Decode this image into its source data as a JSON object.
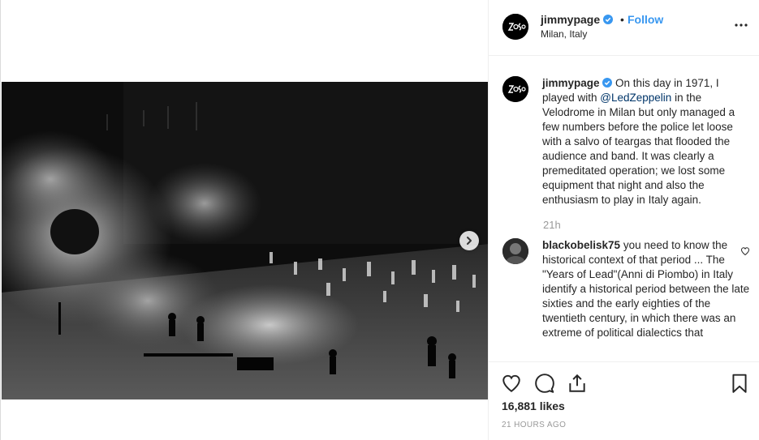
{
  "post": {
    "username": "jimmypage",
    "verified_icon": "verified-badge-icon",
    "dot": "•",
    "follow_label": "Follow",
    "location": "Milan, Italy",
    "more_icon": "more-options-icon"
  },
  "media": {
    "image_icon": "concert-teargas-photo",
    "next_icon": "chevron-right-icon"
  },
  "caption": {
    "username": "jimmypage",
    "text_before": " On this day in 1971, I played with ",
    "mention": "@LedZeppelin",
    "text_after": " in the Velodrome in Milan but only managed a few numbers before the police let loose with a salvo of teargas that flooded the audience and band. It was clearly a premeditated operation; we lost some equipment that night and also the enthusiasm to play in Italy again.",
    "time": "21h"
  },
  "comments": [
    {
      "username": "blackobelisk75",
      "text": " you need to know the historical context of that period ... The \"Years of Lead\"(Anni di Piombo) in Italy identify a historical period between the late sixties and the early eighties of the twentieth century, in which there was an extreme of political dialectics that"
    }
  ],
  "actions": {
    "like_icon": "heart-icon",
    "comment_icon": "comment-icon",
    "share_icon": "share-icon",
    "save_icon": "bookmark-icon",
    "likes": "16,881 likes",
    "posted": "21 HOURS AGO"
  },
  "colors": {
    "link": "#3897f0",
    "mention": "#003569",
    "verified": "#3897f0"
  }
}
